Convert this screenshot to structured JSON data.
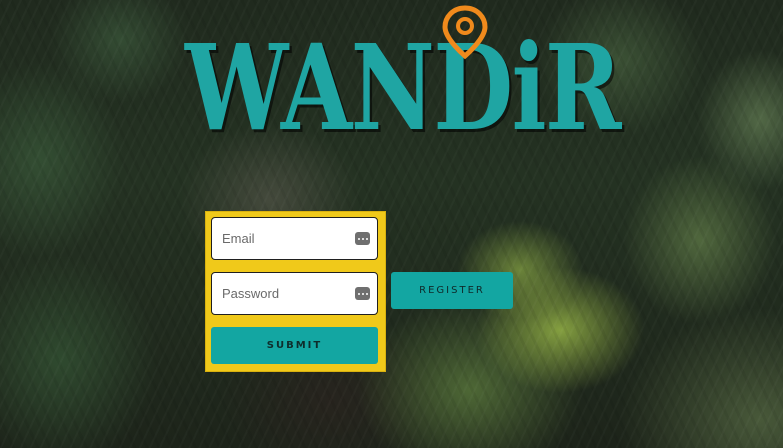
{
  "brand": {
    "logo_text": "WANDiR",
    "primary_color": "#1fa5a3",
    "pin_icon_color": "#f08a1c"
  },
  "login": {
    "email_placeholder": "Email",
    "password_placeholder": "Password",
    "submit_label": "SUBMIT",
    "panel_color": "#f0c91a"
  },
  "register": {
    "label": "REGISTER"
  },
  "icons": {
    "field_icon": "password-manager-icon",
    "logo_icon": "location-pin-icon"
  }
}
